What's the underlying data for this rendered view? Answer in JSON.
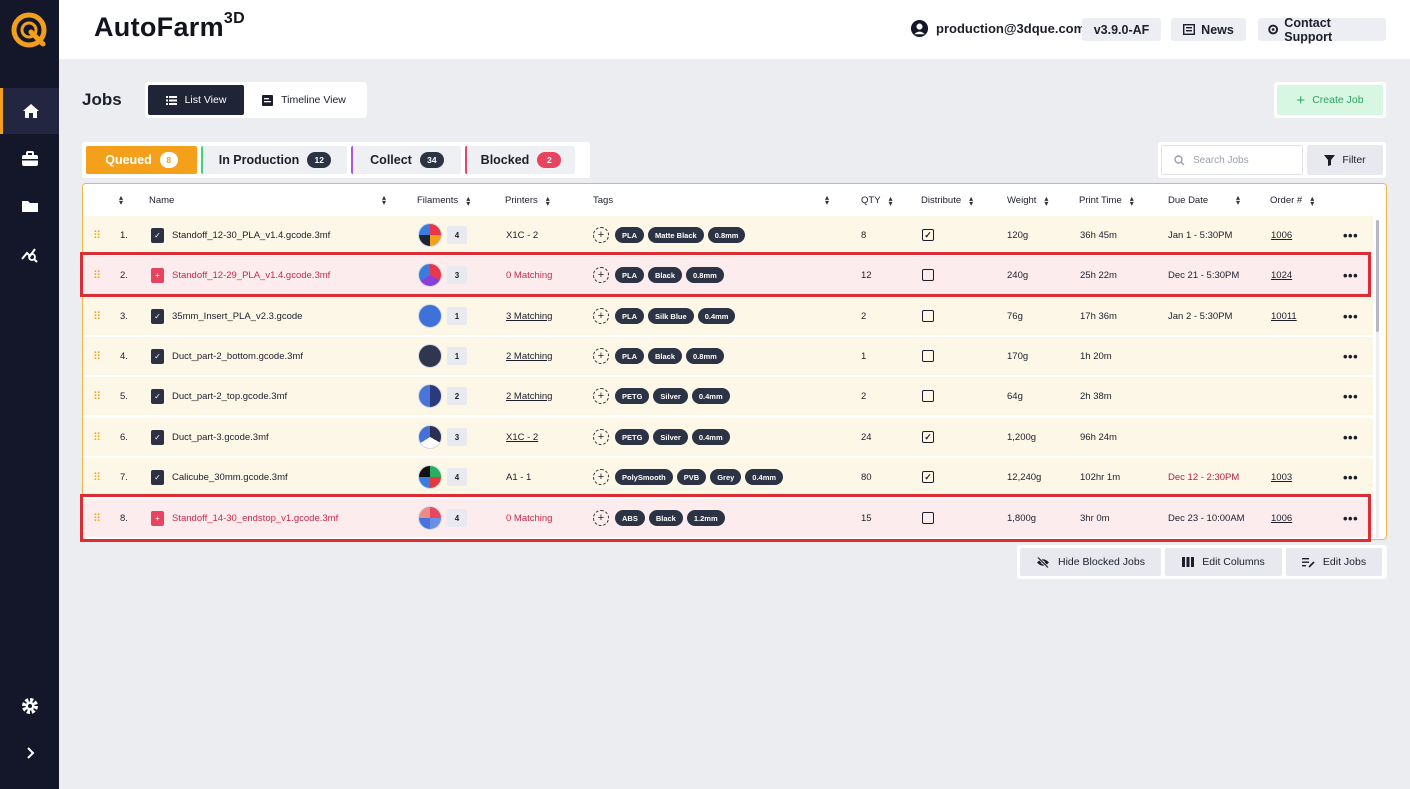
{
  "app": {
    "brand": "AutoFarm",
    "brand_sup": "3D"
  },
  "header": {
    "user_email": "production@3dque.com",
    "version": "v3.9.0-AF",
    "news_label": "News",
    "support_label": "Contact Support"
  },
  "page": {
    "title": "Jobs",
    "list_view_label": "List View",
    "timeline_view_label": "Timeline View",
    "create_job_label": "Create Job"
  },
  "tabs": [
    {
      "label": "Queued",
      "count": "8"
    },
    {
      "label": "In Production",
      "count": "12"
    },
    {
      "label": "Collect",
      "count": "34"
    },
    {
      "label": "Blocked",
      "count": "2"
    }
  ],
  "search": {
    "placeholder": "Search Jobs",
    "filter_label": "Filter"
  },
  "columns": {
    "name": "Name",
    "filaments": "Filaments",
    "printers": "Printers",
    "tags": "Tags",
    "qty": "QTY",
    "distribute": "Distribute",
    "weight": "Weight",
    "print_time": "Print Time",
    "due_date": "Due Date",
    "order": "Order #"
  },
  "rows": [
    {
      "num": "1.",
      "name": "Standoff_12-30_PLA_v1.4.gcode.3mf",
      "fil_count": "4",
      "printers": "X1C - 2",
      "tags": [
        "PLA",
        "Matte Black",
        "0.8mm"
      ],
      "qty": "8",
      "distribute": "✓",
      "weight": "120g",
      "time": "36h 45m",
      "due": "Jan 1 - 5:30PM",
      "order": "1006"
    },
    {
      "num": "2.",
      "name": "Standoff_12-29_PLA_v1.4.gcode.3mf",
      "fil_count": "3",
      "printers": "0 Matching",
      "tags": [
        "PLA",
        "Black",
        "0.8mm"
      ],
      "qty": "12",
      "distribute": "",
      "weight": "240g",
      "time": "25h 22m",
      "due": "Dec 21 - 5:30PM",
      "order": "1024"
    },
    {
      "num": "3.",
      "name": "35mm_Insert_PLA_v2.3.gcode",
      "fil_count": "1",
      "printers": "3 Matching",
      "tags": [
        "PLA",
        "Silk Blue",
        "0.4mm"
      ],
      "qty": "2",
      "distribute": "",
      "weight": "76g",
      "time": "17h 36m",
      "due": "Jan 2 - 5:30PM",
      "order": "10011"
    },
    {
      "num": "4.",
      "name": "Duct_part-2_bottom.gcode.3mf",
      "fil_count": "1",
      "printers": "2 Matching",
      "tags": [
        "PLA",
        "Black",
        "0.8mm"
      ],
      "qty": "1",
      "distribute": "",
      "weight": "170g",
      "time": "1h 20m",
      "due": "",
      "order": ""
    },
    {
      "num": "5.",
      "name": "Duct_part-2_top.gcode.3mf",
      "fil_count": "2",
      "printers": "2 Matching",
      "tags": [
        "PETG",
        "Silver",
        "0.4mm"
      ],
      "qty": "2",
      "distribute": "",
      "weight": "64g",
      "time": "2h 38m",
      "due": "",
      "order": ""
    },
    {
      "num": "6.",
      "name": "Duct_part-3.gcode.3mf",
      "fil_count": "3",
      "printers": "X1C  - 2",
      "tags": [
        "PETG",
        "Silver",
        "0.4mm"
      ],
      "qty": "24",
      "distribute": "✓",
      "weight": "1,200g",
      "time": "96h 24m",
      "due": "",
      "order": ""
    },
    {
      "num": "7.",
      "name": "Calicube_30mm.gcode.3mf",
      "fil_count": "4",
      "printers": "A1 - 1",
      "tags": [
        "PolySmooth",
        "PVB",
        "Grey",
        "0.4mm"
      ],
      "qty": "80",
      "distribute": "✓",
      "weight": "12,240g",
      "time": "102hr 1m",
      "due": "Dec 12 - 2:30PM",
      "order": "1003"
    },
    {
      "num": "8.",
      "name": "Standoff_14-30_endstop_v1.gcode.3mf",
      "fil_count": "4",
      "printers": "0 Matching",
      "tags": [
        "ABS",
        "Black",
        "1.2mm"
      ],
      "qty": "15",
      "distribute": "",
      "weight": "1,800g",
      "time": "3hr 0m",
      "due": "Dec 23 - 10:00AM",
      "order": "1006"
    }
  ],
  "footer": {
    "hide_blocked_label": "Hide Blocked Jobs",
    "edit_columns_label": "Edit Columns",
    "edit_jobs_label": "Edit Jobs"
  },
  "colors": {
    "accent": "#f4a01a",
    "blocked": "#e8445f",
    "sidebar": "#14172a",
    "highlight": "#dc2d35"
  }
}
